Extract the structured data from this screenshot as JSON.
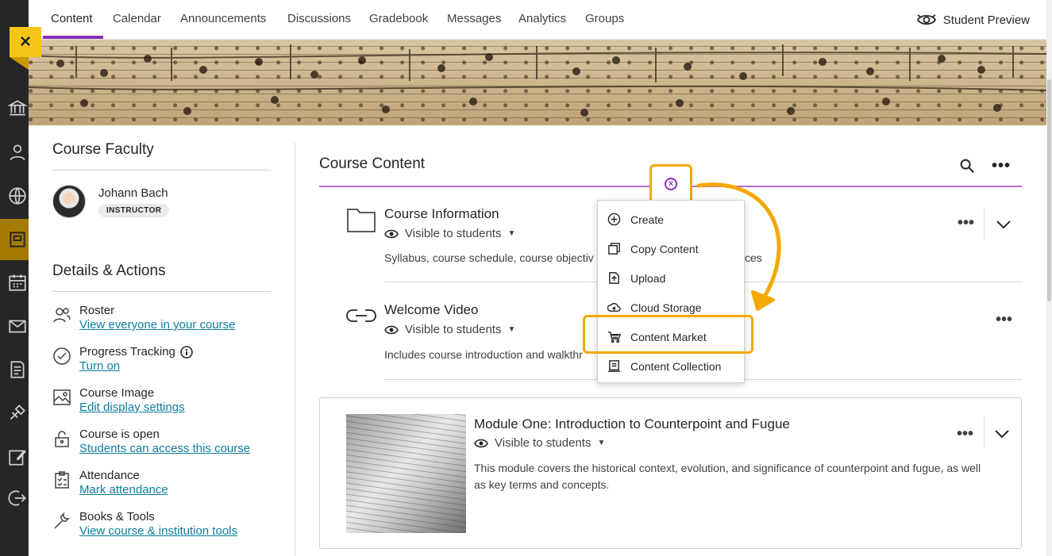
{
  "topnav": {
    "tabs": [
      "Content",
      "Calendar",
      "Announcements",
      "Discussions",
      "Gradebook",
      "Messages",
      "Analytics",
      "Groups"
    ],
    "preview_label": "Student Preview"
  },
  "left_rail": {
    "close_icon": "×",
    "icons": [
      "institution-icon",
      "profile-icon",
      "globe-icon",
      "courses-icon",
      "calendar-icon",
      "messages-icon",
      "grades-icon",
      "tools-icon",
      "edit-icon",
      "sign-out-icon"
    ]
  },
  "faculty": {
    "title": "Course Faculty",
    "name": "Johann Bach",
    "role": "INSTRUCTOR"
  },
  "details": {
    "title": "Details & Actions",
    "items": [
      {
        "label": "Roster",
        "link": "View everyone in your course"
      },
      {
        "label": "Progress Tracking",
        "link": "Turn on"
      },
      {
        "label": "Course Image",
        "link": "Edit display settings"
      },
      {
        "label": "Course is open",
        "link": "Students can access this course"
      },
      {
        "label": "Attendance",
        "link": "Mark attendance"
      },
      {
        "label": "Books & Tools",
        "link": "View course & institution tools"
      }
    ]
  },
  "course_content": {
    "title": "Course Content",
    "items": [
      {
        "title": "Course Information",
        "visibility": "Visible to students",
        "description": "Syllabus, course schedule, course objectiv",
        "description_tail": "ces"
      },
      {
        "title": "Welcome Video",
        "visibility": "Visible to students",
        "description": "Includes course introduction and walkthr"
      },
      {
        "title": "Module One: Introduction to Counterpoint and Fugue",
        "visibility": "Visible to students",
        "description": "This module covers the historical context, evolution, and significance of counterpoint and fugue, as well as key terms and concepts."
      }
    ]
  },
  "add_menu": {
    "items": [
      "Create",
      "Copy Content",
      "Upload",
      "Cloud Storage",
      "Content Market",
      "Content Collection"
    ],
    "highlighted": "Content Market"
  },
  "colors": {
    "accent": "#8b2fb9",
    "callout": "#f2a900",
    "rail": "#262626",
    "link": "#0f7d9e"
  }
}
